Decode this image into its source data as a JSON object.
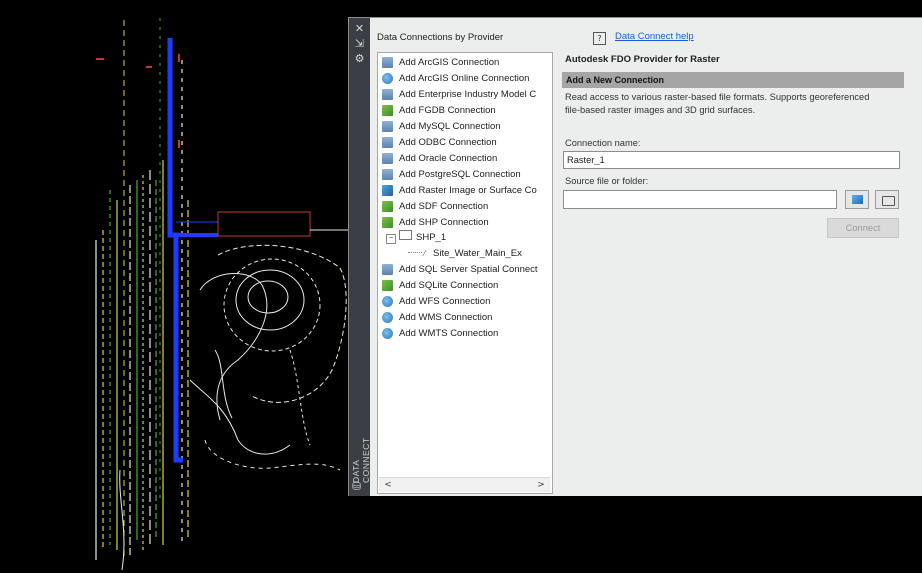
{
  "palette": {
    "strip_title": "DATA CONNECT",
    "strip_icons": [
      "close-icon",
      "pin-icon",
      "settings-icon",
      "database-icon"
    ],
    "providers_title": "Data Connections by Provider",
    "providers": [
      {
        "label": "Add ArcGIS Connection",
        "icon": "database-icon"
      },
      {
        "label": "Add ArcGIS Online Connection",
        "icon": "globe-icon"
      },
      {
        "label": "Add Enterprise Industry Model C",
        "icon": "database-icon"
      },
      {
        "label": "Add FGDB Connection",
        "icon": "geodatabase-icon"
      },
      {
        "label": "Add MySQL Connection",
        "icon": "database-icon"
      },
      {
        "label": "Add ODBC Connection",
        "icon": "database-icon"
      },
      {
        "label": "Add Oracle Connection",
        "icon": "database-icon"
      },
      {
        "label": "Add PostgreSQL Connection",
        "icon": "database-icon"
      },
      {
        "label": "Add Raster Image or Surface Co",
        "icon": "raster-icon"
      },
      {
        "label": "Add SDF Connection",
        "icon": "geodatabase-icon"
      },
      {
        "label": "Add SHP Connection",
        "icon": "geodatabase-icon"
      },
      {
        "label": "Add SQL Server Spatial Connect",
        "icon": "database-icon"
      },
      {
        "label": "Add SQLite Connection",
        "icon": "geodatabase-icon"
      },
      {
        "label": "Add WFS Connection",
        "icon": "globe-icon"
      },
      {
        "label": "Add WMS Connection",
        "icon": "globe-icon"
      },
      {
        "label": "Add WMTS Connection",
        "icon": "globe-icon"
      }
    ],
    "tree": {
      "folder": "SHP_1",
      "child": "Site_Water_Main_Ex"
    },
    "help_icon": "?",
    "help_link": "Data Connect help",
    "provider_heading": "Autodesk FDO Provider for Raster",
    "section": "Add a New Connection",
    "description": "Read access to various raster-based file formats.  Supports georeferenced file-based raster images and 3D grid surfaces.",
    "connection_name_label": "Connection name:",
    "connection_name_value": "Raster_1",
    "source_label": "Source file or folder:",
    "source_value": "",
    "connect_label": "Connect",
    "scroll_left": "<",
    "scroll_right": ">"
  },
  "colors": {
    "canvas": "#000000",
    "palette_bg": "#eceded",
    "strip_bg": "#3a3f45",
    "section_bar": "#a5a5a5",
    "link": "#1a5dd8",
    "cad_blue": "#1e3cff",
    "cad_yellow": "#d8d24a",
    "cad_green": "#3fae3f",
    "cad_white": "#e8e8e8",
    "cad_red": "#c0392b"
  }
}
